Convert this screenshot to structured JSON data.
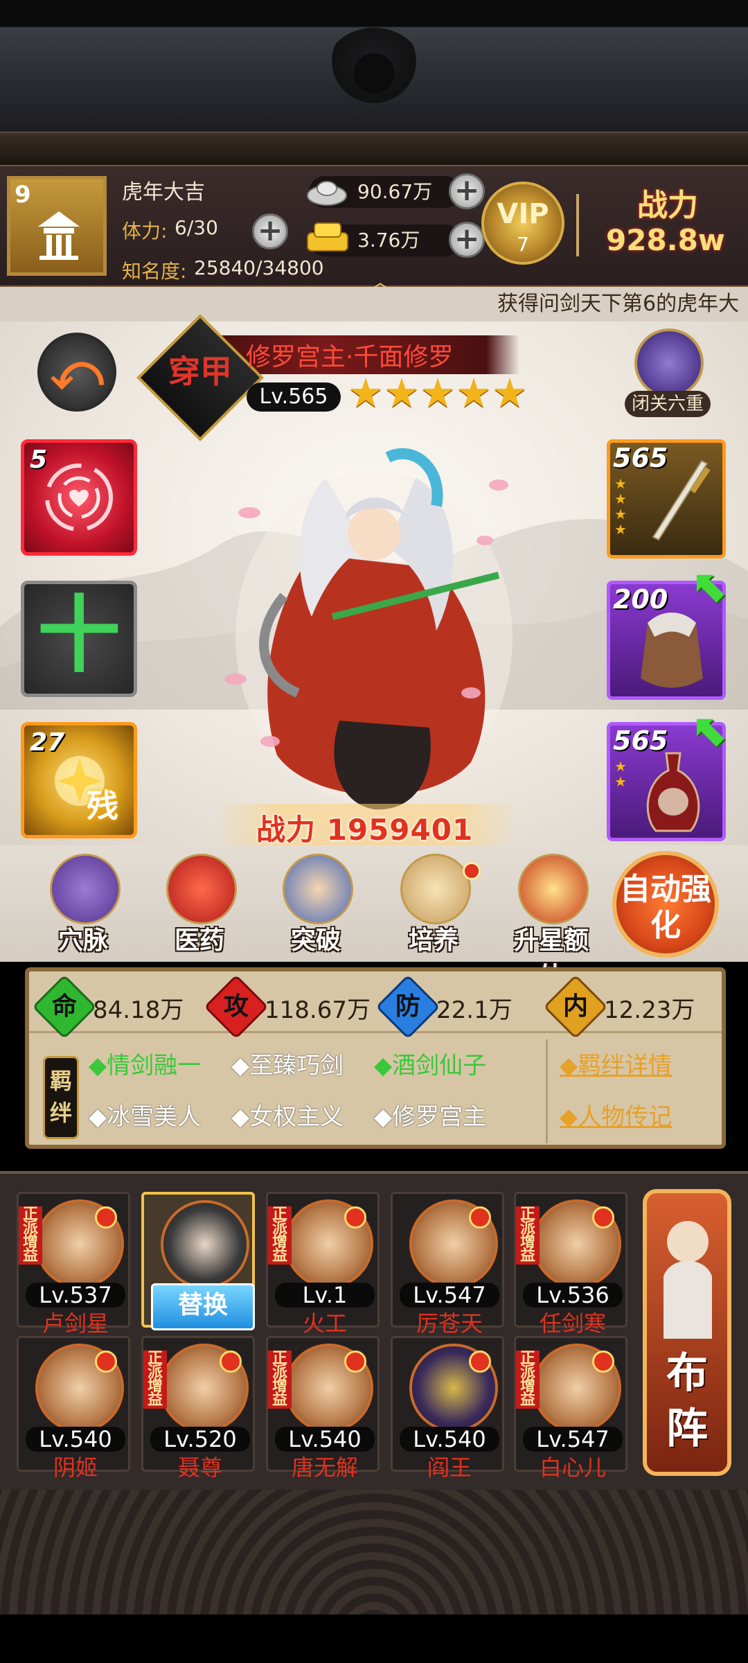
{
  "header": {
    "avatar_level": "9",
    "player_name": "虎年大吉",
    "stamina_label": "体力:",
    "stamina_value": "6/30",
    "fame_label": "知名度:",
    "fame_value": "25840/34800",
    "silver": "90.67万",
    "gold": "3.76万",
    "vip_text": "VIP",
    "vip_level": "7",
    "power_label": "战力",
    "power_value": "928.8w"
  },
  "marquee": "获得问剑天下第6的虎年大",
  "hero": {
    "rank_badge": "穿甲",
    "name": "修罗宫主·千面修罗",
    "level": "Lv.565",
    "stars": 5,
    "power_label": "战力",
    "power_value": "1959401",
    "seclusion_label": "闭关六重"
  },
  "left_slots": {
    "skill_level": "5",
    "empty_symbol": "十",
    "fragment_level": "27",
    "fragment_label": "残"
  },
  "equipment": [
    {
      "level": "565",
      "stars": 4
    },
    {
      "level": "200",
      "stars": 0
    },
    {
      "level": "565",
      "stars": 2
    }
  ],
  "functions": [
    {
      "label": "穴脉"
    },
    {
      "label": "医药"
    },
    {
      "label": "突破"
    },
    {
      "label": "培养"
    },
    {
      "label": "升星额外"
    }
  ],
  "auto_button": "自动强化",
  "stats": [
    {
      "icon": "命",
      "value": "84.18万",
      "color": "#2fb82f"
    },
    {
      "icon": "攻",
      "value": "118.67万",
      "color": "#d82020"
    },
    {
      "icon": "防",
      "value": "22.1万",
      "color": "#2a7ee0"
    },
    {
      "icon": "内",
      "value": "12.23万",
      "color": "#e0a020"
    }
  ],
  "fetter": {
    "tag": "羁绊",
    "row1": [
      "◆情剑融一",
      "◆至臻巧剑",
      "◆酒剑仙子"
    ],
    "row2": [
      "◆冰雪美人",
      "◆女权主义",
      "◆修罗宫主"
    ],
    "details_link": "◆羁绊详情",
    "bio_link": "◆人物传记"
  },
  "lineup": [
    {
      "level": "Lv.537",
      "name": "卢剑星",
      "badge": "正派增益"
    },
    {
      "level": "",
      "name": "",
      "badge": "",
      "swap": "替换"
    },
    {
      "level": "Lv.1",
      "name": "火工",
      "badge": "正派增益"
    },
    {
      "level": "Lv.547",
      "name": "厉苍天",
      "badge": ""
    },
    {
      "level": "Lv.536",
      "name": "任剑寒",
      "badge": "正派增益"
    },
    {
      "level": "Lv.540",
      "name": "阴姬",
      "badge": ""
    },
    {
      "level": "Lv.520",
      "name": "聂尊",
      "badge": "正派增益"
    },
    {
      "level": "Lv.540",
      "name": "唐无解",
      "badge": "正派增益"
    },
    {
      "level": "Lv.540",
      "name": "阎王",
      "badge": ""
    },
    {
      "level": "Lv.547",
      "name": "白心儿",
      "badge": "正派增益"
    }
  ],
  "formation_button": "布阵"
}
